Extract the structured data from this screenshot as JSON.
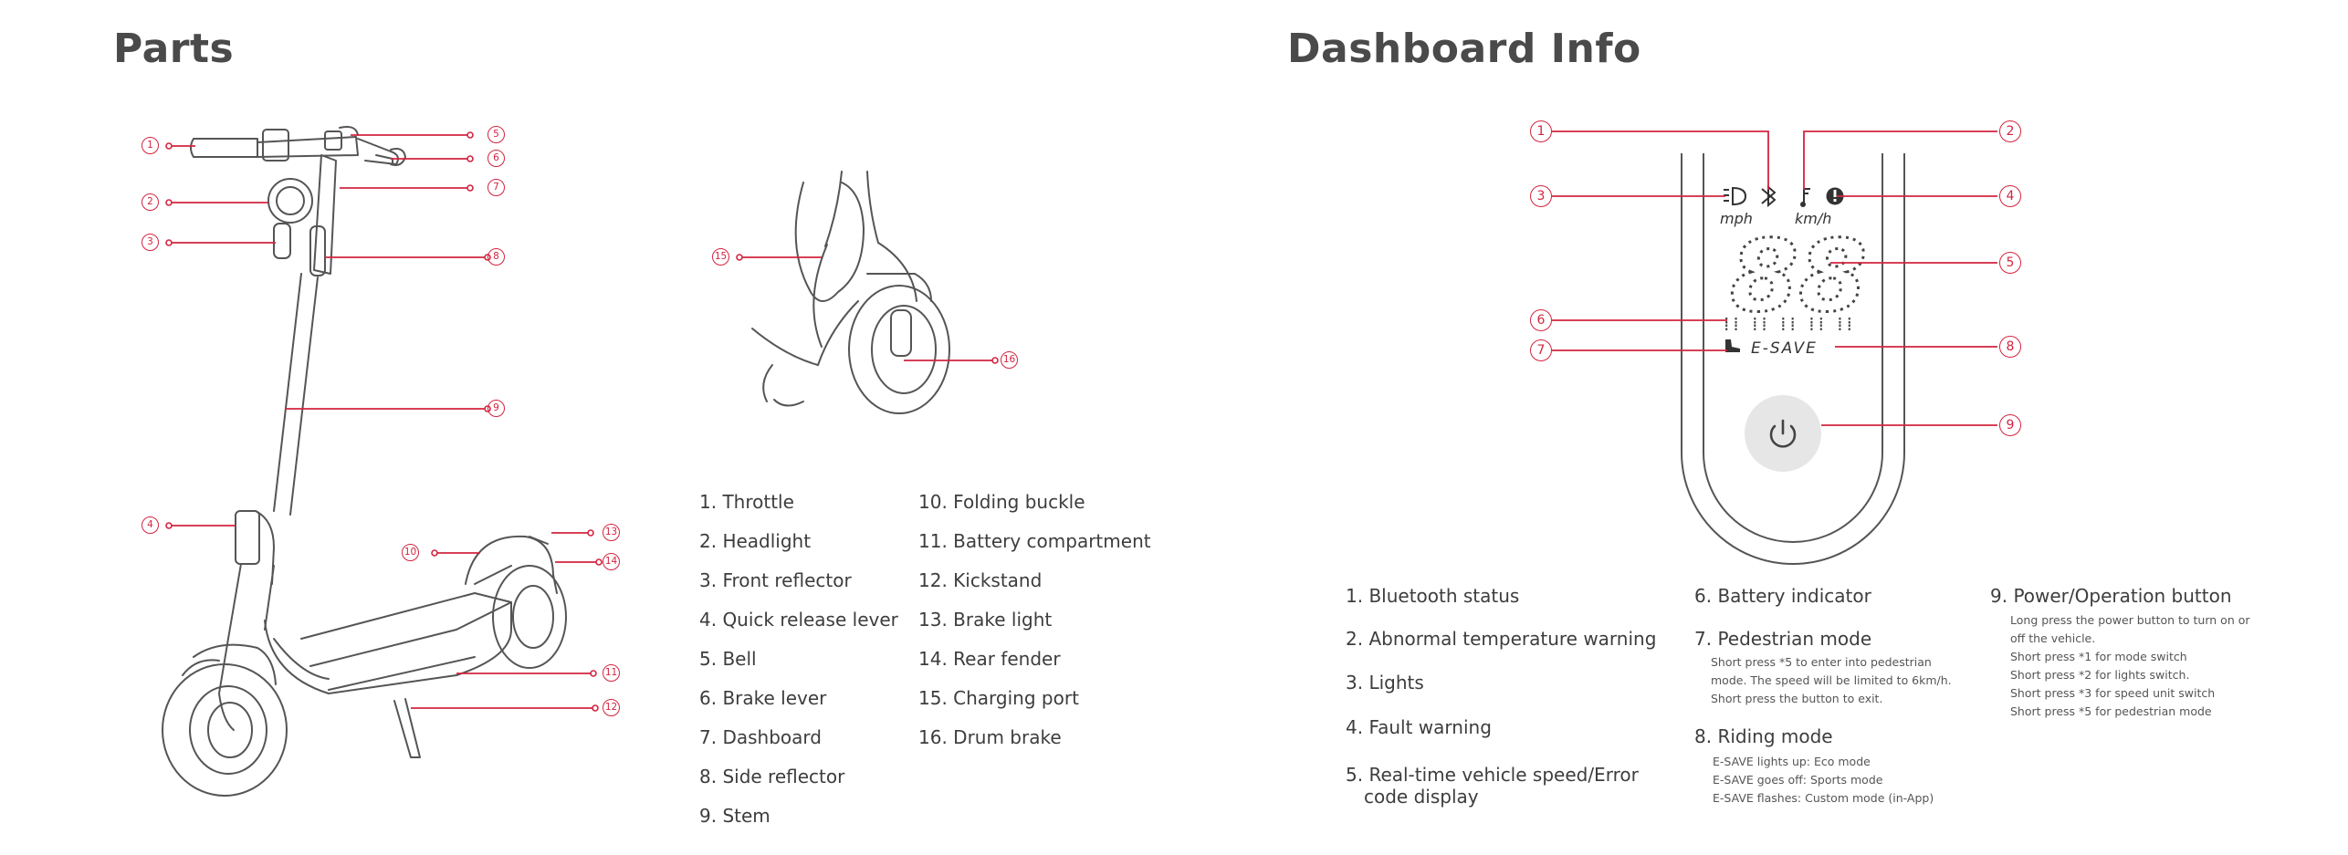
{
  "parts": {
    "title": "Parts",
    "callouts": [
      "1",
      "2",
      "3",
      "4",
      "5",
      "6",
      "7",
      "8",
      "9",
      "10",
      "11",
      "12",
      "13",
      "14",
      "15",
      "16"
    ],
    "list_col1": [
      "1. Throttle",
      "2. Headlight",
      "3. Front reflector",
      "4. Quick release lever",
      "5. Bell",
      "6. Brake lever",
      "7. Dashboard",
      "8. Side reflector",
      "9. Stem"
    ],
    "list_col2": [
      "10. Folding buckle",
      "11. Battery compartment",
      "12. Kickstand",
      "13. Brake light",
      "14. Rear fender",
      "15. Charging port",
      "16. Drum brake"
    ]
  },
  "dashboard": {
    "title": "Dashboard Info",
    "callouts": [
      "1",
      "2",
      "3",
      "4",
      "5",
      "6",
      "7",
      "8",
      "9"
    ],
    "display": {
      "unit_left": "mph",
      "unit_right": "km/h",
      "speed_digits": "88",
      "mode_label": "E-SAVE"
    },
    "items": {
      "i1": "1. Bluetooth status",
      "i2": "2. Abnormal temperature warning",
      "i3": "3. Lights",
      "i4": "4. Fault warning",
      "i5_line1": "5. Real-time vehicle speed/Error",
      "i5_line2": "code display",
      "i6": "6. Battery indicator",
      "i7": "7. Pedestrian mode",
      "i7_desc": [
        "Short press *5 to enter into pedestrian",
        "mode. The speed will be limited to 6km/h.",
        "Short press the button to exit."
      ],
      "i8": "8. Riding mode",
      "i8_desc": [
        "E-SAVE lights up: Eco mode",
        "E-SAVE goes off: Sports mode",
        "E-SAVE flashes: Custom mode (in-App)"
      ],
      "i9": "9. Power/Operation button",
      "i9_desc": [
        "Long press the power button to turn on or",
        "off the vehicle.",
        "Short press *1 for mode switch",
        "Short press *2 for lights switch.",
        "Short press *3 for speed unit switch",
        "Short press *5 for pedestrian mode"
      ]
    }
  },
  "colors": {
    "accent": "#d3243f",
    "line_art": "#555555",
    "text": "#3d3d3d"
  }
}
